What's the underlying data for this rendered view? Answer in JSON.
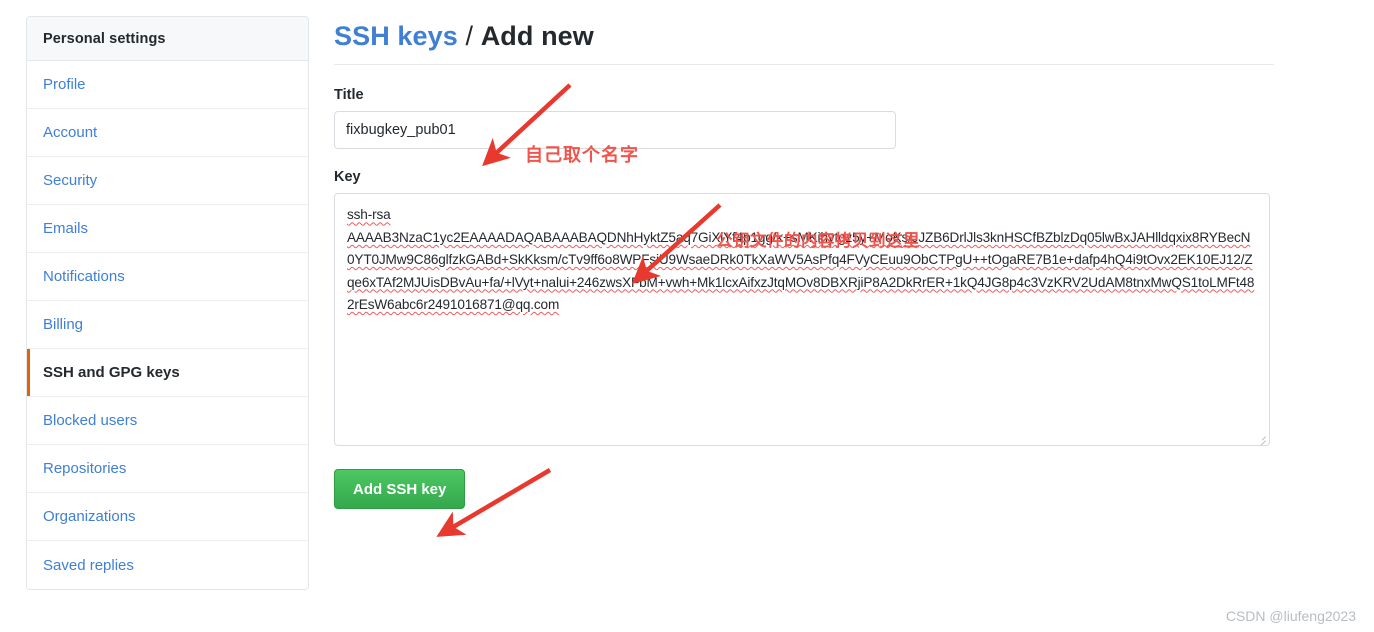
{
  "sidebar": {
    "header": "Personal settings",
    "items": [
      {
        "label": "Profile",
        "selected": false
      },
      {
        "label": "Account",
        "selected": false
      },
      {
        "label": "Security",
        "selected": false
      },
      {
        "label": "Emails",
        "selected": false
      },
      {
        "label": "Notifications",
        "selected": false
      },
      {
        "label": "Billing",
        "selected": false
      },
      {
        "label": "SSH and GPG keys",
        "selected": true
      },
      {
        "label": "Blocked users",
        "selected": false
      },
      {
        "label": "Repositories",
        "selected": false
      },
      {
        "label": "Organizations",
        "selected": false
      },
      {
        "label": "Saved replies",
        "selected": false
      }
    ]
  },
  "page": {
    "title_link": "SSH keys",
    "title_separator": " / ",
    "title_tail": "Add new"
  },
  "form": {
    "title_label": "Title",
    "title_value": "fixbugkey_pub01",
    "title_placeholder": "",
    "key_label": "Key",
    "key_value": "ssh-rsa\nAAAAB3NzaC1yc2EAAAADAQABAAABAQDNhHyktZ5aq7GiXlYf4p1gg/k+sMKihytgz5y+MoKs/JJZB6DrlJls3knHSCfBZblzDq05lwBxJAHlldqxix8RYBecN0YT0JMw9C86glfzkGABd+SkKksm/cTv9ff6o8WPFsiU9WsaeDRk0TkXaWV5AsPfq4FVyCEuu9ObCTPgU++tOgaRE7B1e+dafp4hQ4i9tOvx2EK10EJ12/Zqe6xTAf2MJUisDBvAu+fa/+lVyt+nalui+246zwsXFbM+vwh+Mk1lcxAifxzJtqMOv8DBXRjiP8A2DkRrER+1kQ4JG8p4c3VzKRV2UdAM8tnxMwQS1toLMFt482rEsW6abc6r2491016871@qq.com",
    "key_placeholder": "",
    "submit_label": "Add SSH key"
  },
  "annotations": {
    "title_note": "自己取个名字",
    "key_note": "公钥文件的内容拷贝到这里",
    "arrow_color": "#e8392e"
  },
  "watermark": "CSDN @liufeng2023",
  "colors": {
    "link_blue": "#3f7fd4",
    "selected_marker_orange": "#e36209",
    "submit_green": "#34a84c",
    "annotation_red": "#f1544c",
    "spellcheck_red": "#f05b5b"
  }
}
